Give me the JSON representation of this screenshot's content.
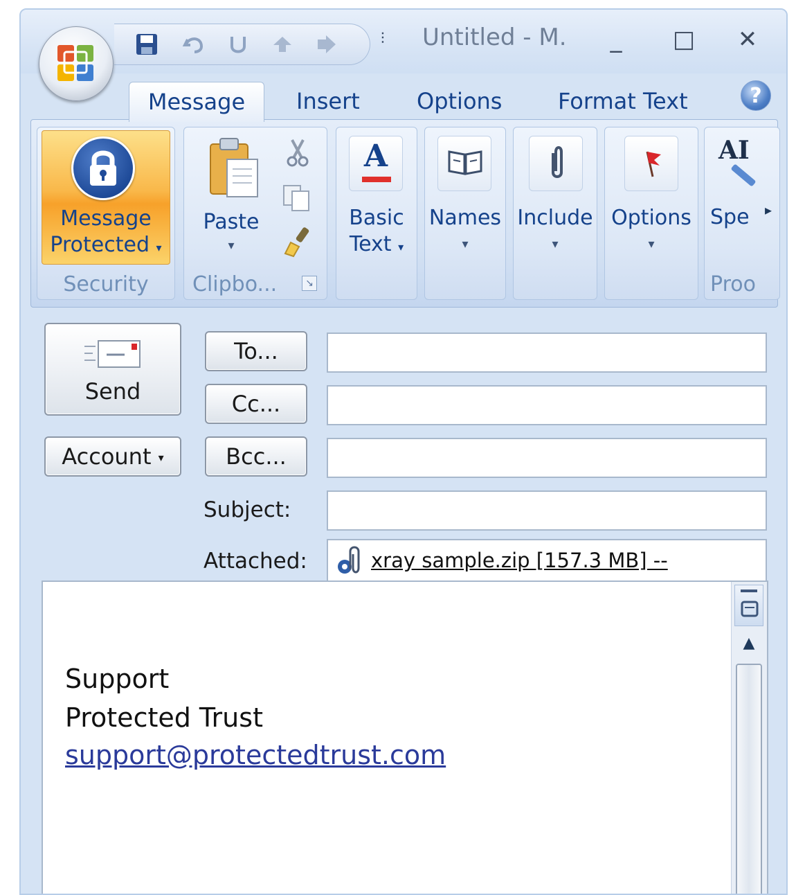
{
  "window": {
    "title": "Untitled - M.",
    "minimize_glyph": "_",
    "maximize_glyph": "□",
    "close_glyph": "✕"
  },
  "quick_access": {
    "icons": [
      "save-icon",
      "undo-icon",
      "redo-icon",
      "previous-item-icon",
      "next-item-icon"
    ],
    "customize_glyph": "⫶"
  },
  "tabs": [
    {
      "label": "Message",
      "active": true
    },
    {
      "label": "Insert"
    },
    {
      "label": "Options"
    },
    {
      "label": "Format Text"
    }
  ],
  "help_glyph": "?",
  "ribbon": {
    "security": {
      "button_line1": "Message",
      "button_line2": "Protected",
      "group_label": "Security"
    },
    "clipboard": {
      "paste_label": "Paste",
      "group_label": "Clipbo..."
    },
    "basic_text": {
      "line1": "Basic",
      "line2": "Text",
      "icon_letter": "A"
    },
    "names": {
      "label": "Names"
    },
    "include": {
      "label": "Include"
    },
    "options": {
      "label": "Options"
    },
    "proofing": {
      "icon_text": "AI",
      "label": "Spe",
      "group_label": "Proo"
    },
    "more_glyph": "▸"
  },
  "form": {
    "send_label": "Send",
    "account_label": "Account",
    "to_label": "To...",
    "cc_label": "Cc...",
    "bcc_label": "Bcc...",
    "subject_label": "Subject:",
    "attached_label": "Attached:",
    "to_value": "",
    "cc_value": "",
    "bcc_value": "",
    "subject_value": "",
    "attachment": "xray sample.zip [157.3 MB] --"
  },
  "signature": {
    "line1": "Support",
    "line2": "Protected Trust",
    "email": "support@protectedtrust.com"
  },
  "colors": {
    "accent": "#15428b",
    "security_button": "#f9b84a",
    "link": "#2a3a9a"
  }
}
